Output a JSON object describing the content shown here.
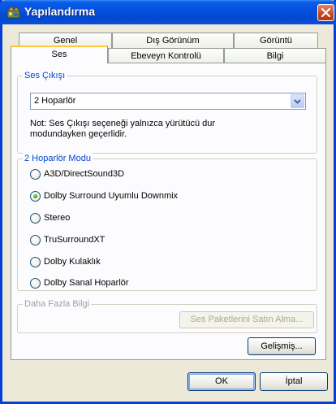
{
  "window": {
    "title": "Yapılandırma"
  },
  "tabs_back": [
    "Genel",
    "Dış Görünüm",
    "Görüntü"
  ],
  "tabs_front": [
    "Ses",
    "Ebeveyn Kontrolü",
    "Bilgi"
  ],
  "output_group": {
    "legend": "Ses Çıkışı",
    "selected": "2 Hoparlör",
    "note_line1": "Not: Ses Çıkışı seçeneği yalnızca yürütücü dur",
    "note_line2": "modundayken geçerlidir."
  },
  "mode_group": {
    "legend": "2 Hoparlör Modu",
    "options": [
      {
        "label": "A3D/DirectSound3D",
        "selected": false
      },
      {
        "label": "Dolby Surround Uyumlu Downmix",
        "selected": true
      },
      {
        "label": "Stereo",
        "selected": false
      },
      {
        "label": "TruSurroundXT",
        "selected": false
      },
      {
        "label": "Dolby Kulaklık",
        "selected": false
      },
      {
        "label": "Dolby Sanal Hoparlör",
        "selected": false
      }
    ]
  },
  "info_group": {
    "legend": "Daha Fazla Bilgi",
    "buy_button": "Ses Paketlerini Satın Alma..."
  },
  "advanced_button": "Gelişmiş...",
  "ok_button": "OK",
  "cancel_button": "İptal",
  "colors": {
    "title_blue": "#0550dc",
    "legend_blue": "#0046d5",
    "tab_highlight": "#ffc83c"
  }
}
